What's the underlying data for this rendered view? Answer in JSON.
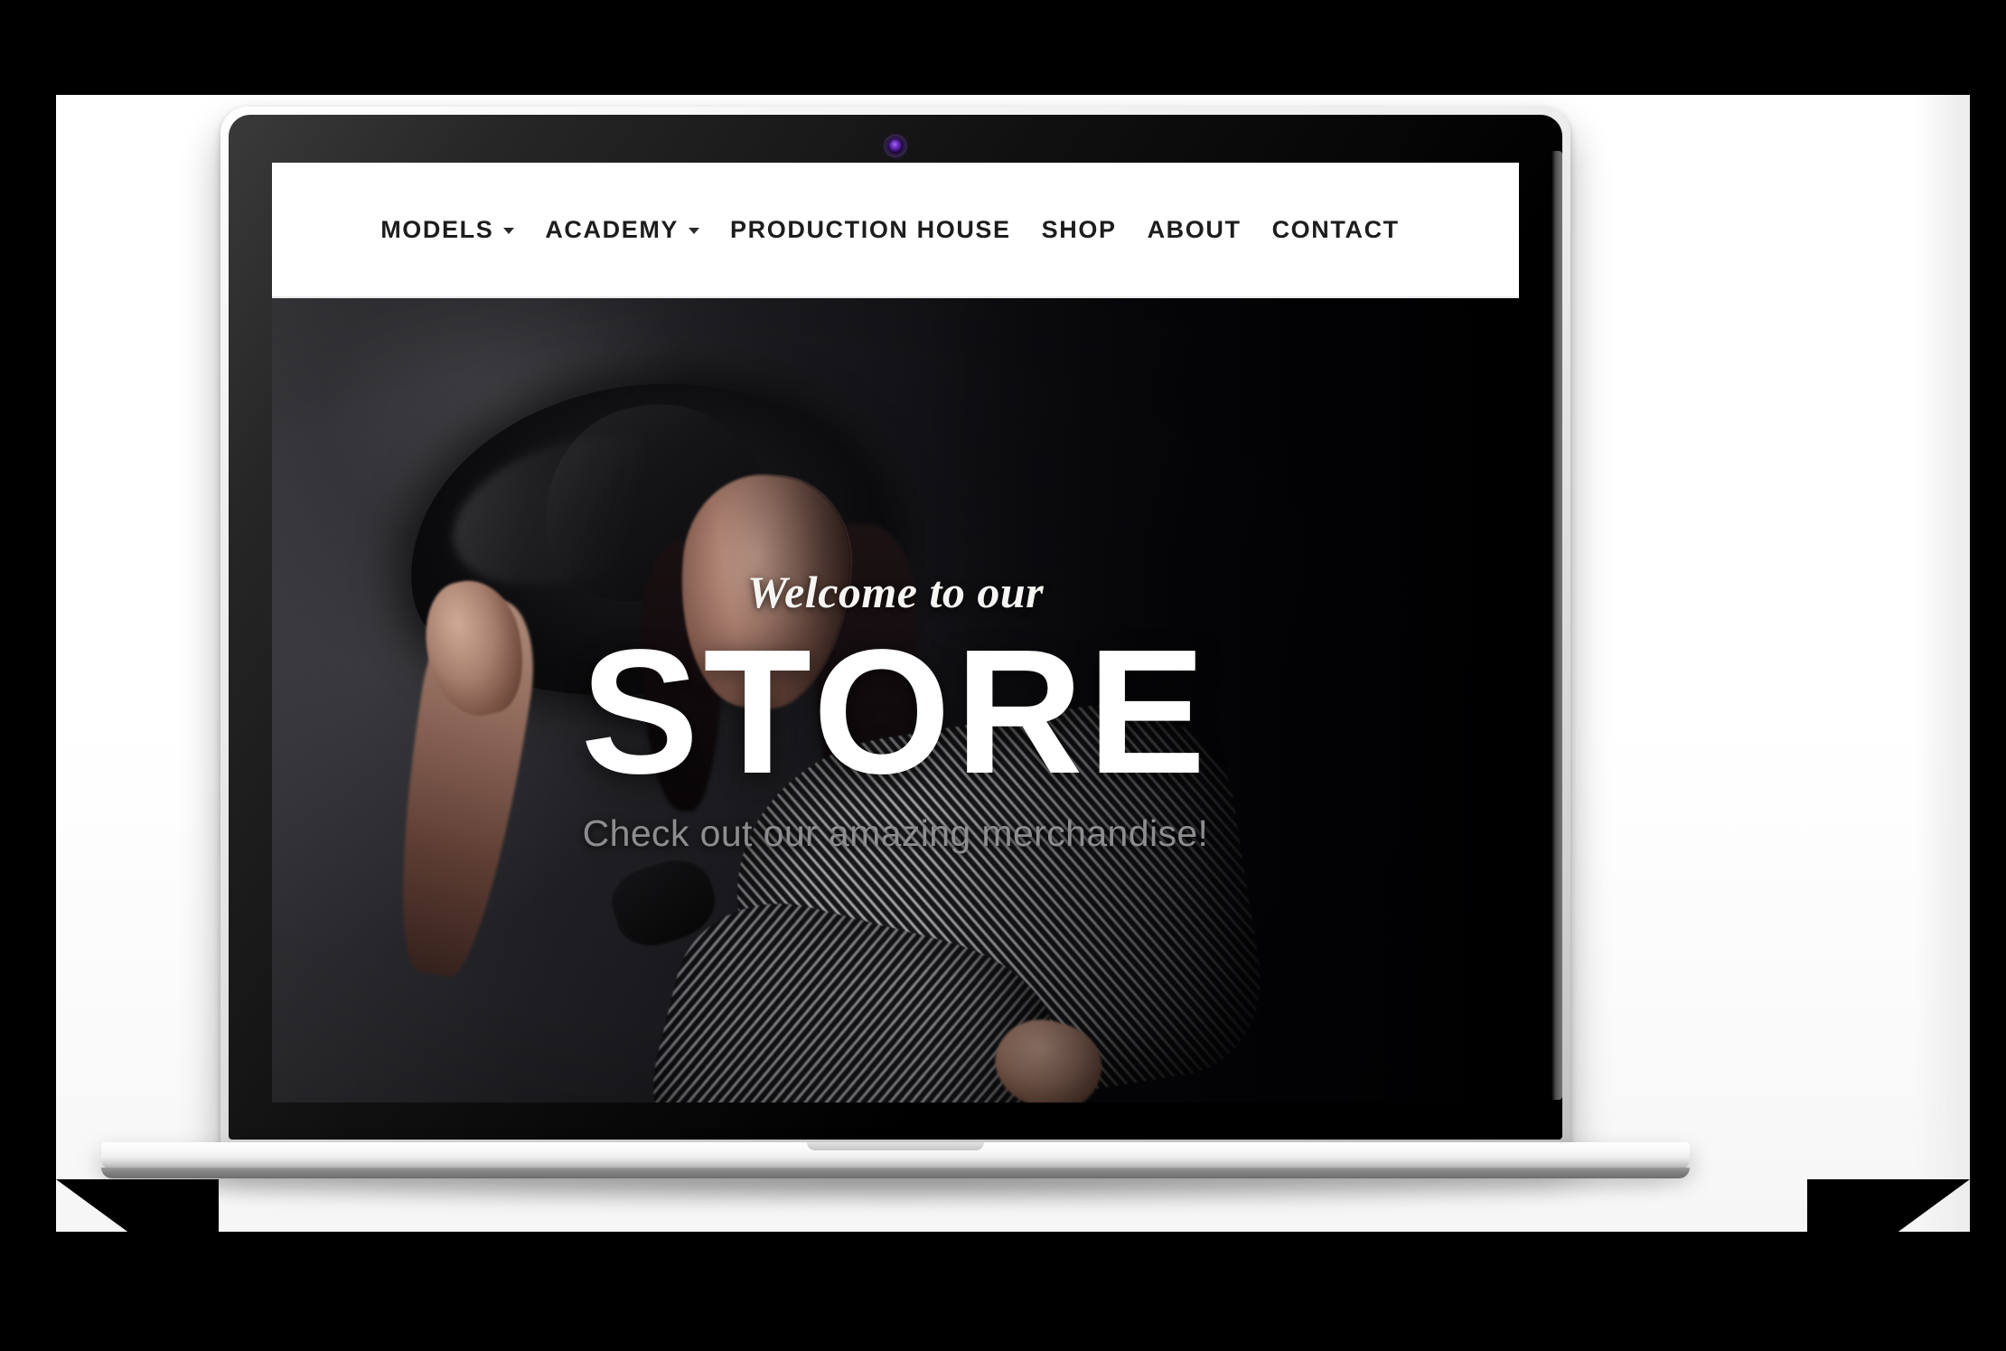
{
  "device": {
    "type": "laptop-mockup",
    "webcam_icon": "webcam-indicator-icon",
    "bezel_color": "#0a0a0a",
    "lid_color": "#e6e6e6",
    "base_color": "#efefef"
  },
  "site": {
    "nav": {
      "items": [
        {
          "label": "MODELS",
          "has_dropdown": true,
          "caret_icon": "chevron-down-icon"
        },
        {
          "label": "ACADEMY",
          "has_dropdown": true,
          "caret_icon": "chevron-down-icon"
        },
        {
          "label": "PRODUCTION HOUSE",
          "has_dropdown": false
        },
        {
          "label": "SHOP",
          "has_dropdown": false
        },
        {
          "label": "ABOUT",
          "has_dropdown": false
        },
        {
          "label": "CONTACT",
          "has_dropdown": false
        }
      ],
      "background": "#ffffff",
      "text_color": "#1d1d1d"
    },
    "hero": {
      "eyebrow": "Welcome to our",
      "title": "STORE",
      "subtitle": "Check out our amazing merchandise!",
      "title_color": "#ffffff",
      "subtitle_color": "#8d8d90",
      "background_description": "Dark studio portrait of a model in a wide-brim black hat and striped knit garment"
    }
  },
  "canvas": {
    "matte_color": "#000000",
    "surface_color": "#ffffff"
  }
}
